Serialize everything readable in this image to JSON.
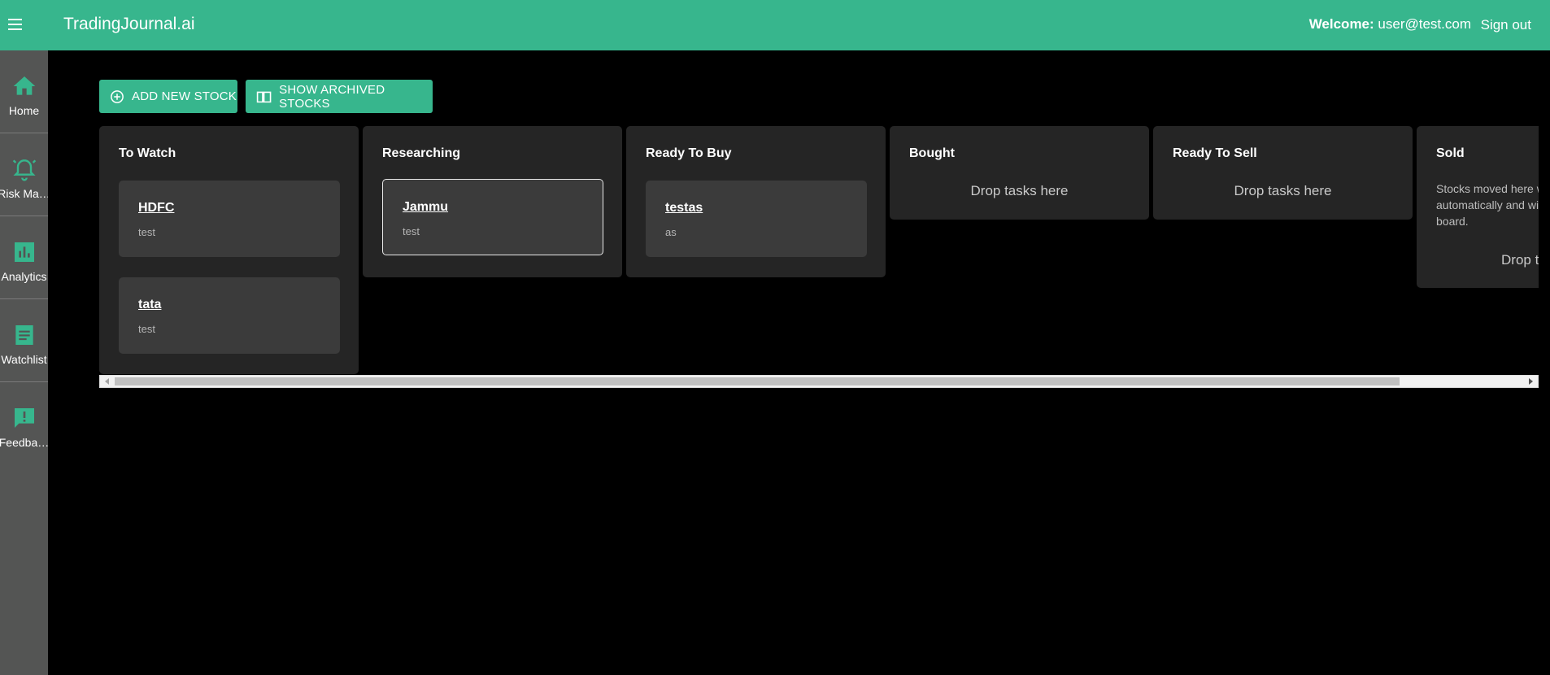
{
  "header": {
    "app_title": "TradingJournal.ai",
    "welcome_label": "Welcome:",
    "user_email": "user@test.com",
    "sign_out": "Sign out"
  },
  "sidebar": {
    "items": [
      {
        "label": "Home",
        "icon": "home-icon"
      },
      {
        "label": "Risk Ma…",
        "icon": "alarm-icon"
      },
      {
        "label": "Analytics",
        "icon": "bar-chart-icon"
      },
      {
        "label": "Watchlist",
        "icon": "list-icon"
      },
      {
        "label": "Feedba…",
        "icon": "feedback-icon"
      }
    ]
  },
  "actions": {
    "add_new_stock": "ADD NEW STOCK",
    "show_archived": "SHOW ARCHIVED STOCKS"
  },
  "board": {
    "columns": [
      {
        "title": "To Watch",
        "cards": [
          {
            "title": "HDFC",
            "desc": "test"
          },
          {
            "title": "tata",
            "desc": "test"
          }
        ]
      },
      {
        "title": "Researching",
        "cards": [
          {
            "title": "Jammu",
            "desc": "test"
          }
        ]
      },
      {
        "title": "Ready To Buy",
        "cards": [
          {
            "title": "testas",
            "desc": "as"
          }
        ]
      },
      {
        "title": "Bought",
        "drop_hint": "Drop tasks here"
      },
      {
        "title": "Ready To Sell",
        "drop_hint": "Drop tasks here"
      },
      {
        "title": "Sold",
        "desc": "Stocks moved here will be archived automatically and will no longer appear on the board.",
        "drop_hint": "Drop tasks here"
      }
    ]
  },
  "colors": {
    "accent": "#37b68d",
    "sidebar": "#545554",
    "column": "#252525",
    "card": "#3b3b3b"
  }
}
